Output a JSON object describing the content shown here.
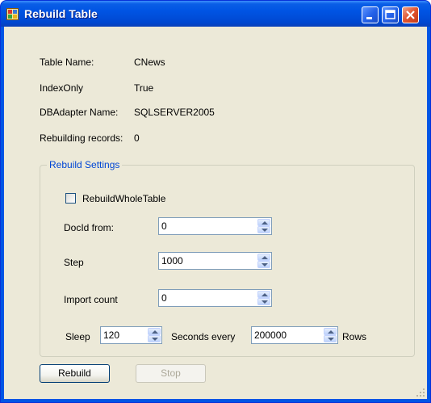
{
  "window": {
    "title": "Rebuild Table"
  },
  "info": {
    "table_name_label": "Table Name:",
    "table_name_value": "CNews",
    "index_only_label": "IndexOnly",
    "index_only_value": "True",
    "dbadapter_label": "DBAdapter Name:",
    "dbadapter_value": "SQLSERVER2005",
    "rebuilding_label": "Rebuilding records:",
    "rebuilding_value": "0"
  },
  "settings": {
    "group_title": "Rebuild Settings",
    "rebuild_whole_table_label": "RebuildWholeTable",
    "rebuild_whole_table_checked": false,
    "docid_from_label": "DocId from:",
    "docid_from_value": "0",
    "step_label": "Step",
    "step_value": "1000",
    "import_count_label": "Import count",
    "import_count_value": "0",
    "sleep_label": "Sleep",
    "sleep_value": "120",
    "seconds_every_label": "Seconds every",
    "rows_value": "200000",
    "rows_label": "Rows"
  },
  "buttons": {
    "rebuild": "Rebuild",
    "stop": "Stop"
  },
  "icons": {
    "app": "app-table-icon",
    "minimize": "minimize-icon",
    "maximize": "maximize-icon",
    "close": "close-icon"
  }
}
